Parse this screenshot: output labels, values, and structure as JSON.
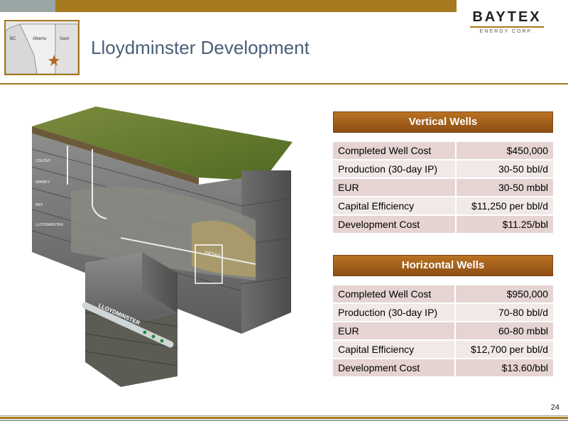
{
  "header": {
    "title": "Lloydminster Development",
    "logo": {
      "name": "BAYTEX",
      "tagline": "ENERGY CORP."
    },
    "map": {
      "labels": [
        "BC",
        "Alberta",
        "Sask"
      ]
    }
  },
  "diagram": {
    "formation_labels": [
      "COLONY",
      "SPARKY",
      "REX",
      "LLOYDMINSTER"
    ],
    "detail_label": "DETAIL",
    "block_label": "LLOYDMINSTER"
  },
  "vertical_wells": {
    "header": "Vertical Wells",
    "rows": [
      {
        "label": "Completed Well Cost",
        "value": "$450,000"
      },
      {
        "label": "Production (30-day IP)",
        "value": "30-50 bbl/d"
      },
      {
        "label": "EUR",
        "value": "30-50 mbbl"
      },
      {
        "label": "Capital Efficiency",
        "value": "$11,250 per bbl/d"
      },
      {
        "label": "Development Cost",
        "value": "$11.25/bbl"
      }
    ]
  },
  "horizontal_wells": {
    "header": "Horizontal Wells",
    "rows": [
      {
        "label": "Completed Well Cost",
        "value": "$950,000"
      },
      {
        "label": "Production (30-day IP)",
        "value": "70-80 bbl/d"
      },
      {
        "label": "EUR",
        "value": "60-80 mbbl"
      },
      {
        "label": "Capital Efficiency",
        "value": "$12,700 per bbl/d"
      },
      {
        "label": "Development Cost",
        "value": "$13.60/bbl"
      }
    ]
  },
  "footer": {
    "page_number": "24"
  },
  "colors": {
    "accent_gold": "#a67a1e",
    "header_brown": "#8e4e14",
    "title_blue": "#4a5f77",
    "row_tint": "#e5d4d2"
  },
  "icons": {
    "map_marker": "star-icon"
  }
}
